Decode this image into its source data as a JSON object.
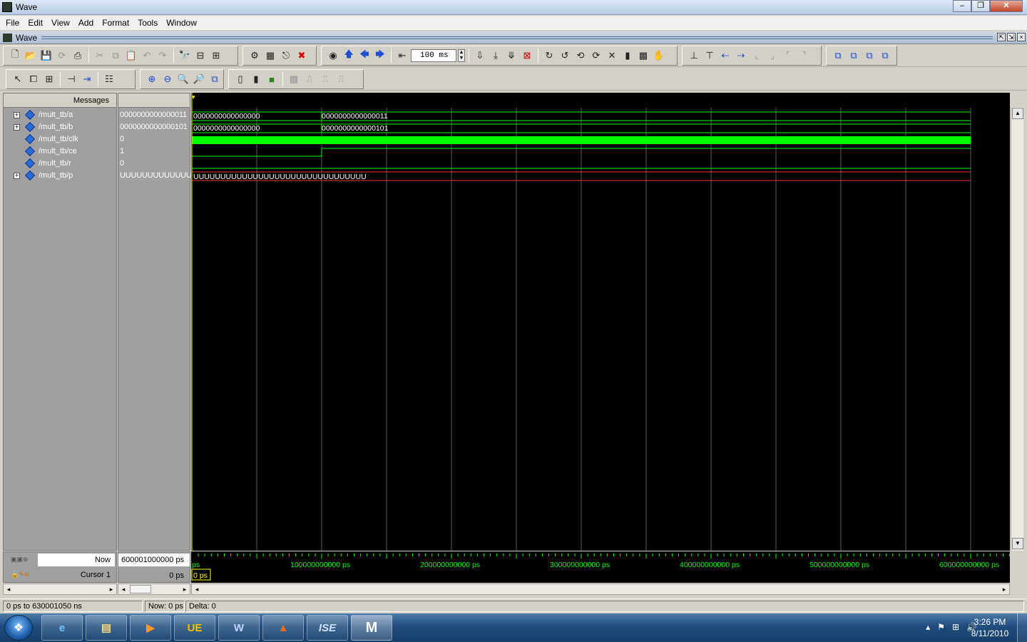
{
  "window": {
    "title": "Wave",
    "min": "–",
    "max": "❐",
    "close": "✕"
  },
  "menu": [
    "File",
    "Edit",
    "View",
    "Add",
    "Format",
    "Tools",
    "Window"
  ],
  "pane": {
    "title": "Wave"
  },
  "toolbar": {
    "zoom_value": "100 ms"
  },
  "headers": {
    "messages": "Messages"
  },
  "signals": [
    {
      "name": "/mult_tb/a",
      "value": "0000000000000011",
      "expandable": true
    },
    {
      "name": "/mult_tb/b",
      "value": "0000000000000101",
      "expandable": true
    },
    {
      "name": "/mult_tb/clk",
      "value": "0",
      "expandable": false
    },
    {
      "name": "/mult_tb/ce",
      "value": "1",
      "expandable": false
    },
    {
      "name": "/mult_tb/r",
      "value": "0",
      "expandable": false
    },
    {
      "name": "/mult_tb/p",
      "value": "UUUUUUUUUUUUUUUU",
      "expandable": true
    }
  ],
  "wave_labels": {
    "a_before": "0000000000000000",
    "a_after": "0000000000000011",
    "b_before": "0000000000000000",
    "b_after": "0000000000000101",
    "p_value": "UUUUUUUUUUUUUUUUUUUUUUUUUUUUUUUU"
  },
  "cursor_panel": {
    "now_label": "Now",
    "now_value": "600001000000 ps",
    "cursor_label": "Cursor 1",
    "cursor_value": "0 ps",
    "cursor_flag": "0 ps"
  },
  "timeline": {
    "start_label": "ps",
    "ticks": [
      {
        "time": 100000000000,
        "label": "100000000000 ps"
      },
      {
        "time": 200000000000,
        "label": "200000000000 ps"
      },
      {
        "time": 300000000000,
        "label": "300000000000 ps"
      },
      {
        "time": 400000000000,
        "label": "400000000000 ps"
      },
      {
        "time": 500000000000,
        "label": "500000000000 ps"
      },
      {
        "time": 600000000000,
        "label": "600000000000 ps"
      }
    ]
  },
  "status": {
    "range": "0 ps to 630001050 ns",
    "now": "Now: 0 ps",
    "delta": "Delta: 0"
  },
  "taskbar": {
    "items": [
      "e",
      "▤",
      "▶",
      "UE",
      "W",
      "▲",
      "ISE",
      "M"
    ],
    "time": "3:26 PM",
    "date": "8/11/2010"
  },
  "colors": {
    "wave_bg": "#000000",
    "signal_green": "#00ff00",
    "signal_red": "#ff3030",
    "cursor_yellow": "#ffff00",
    "grid": "#5a5a5a",
    "timeline_text": "#00ff00"
  }
}
